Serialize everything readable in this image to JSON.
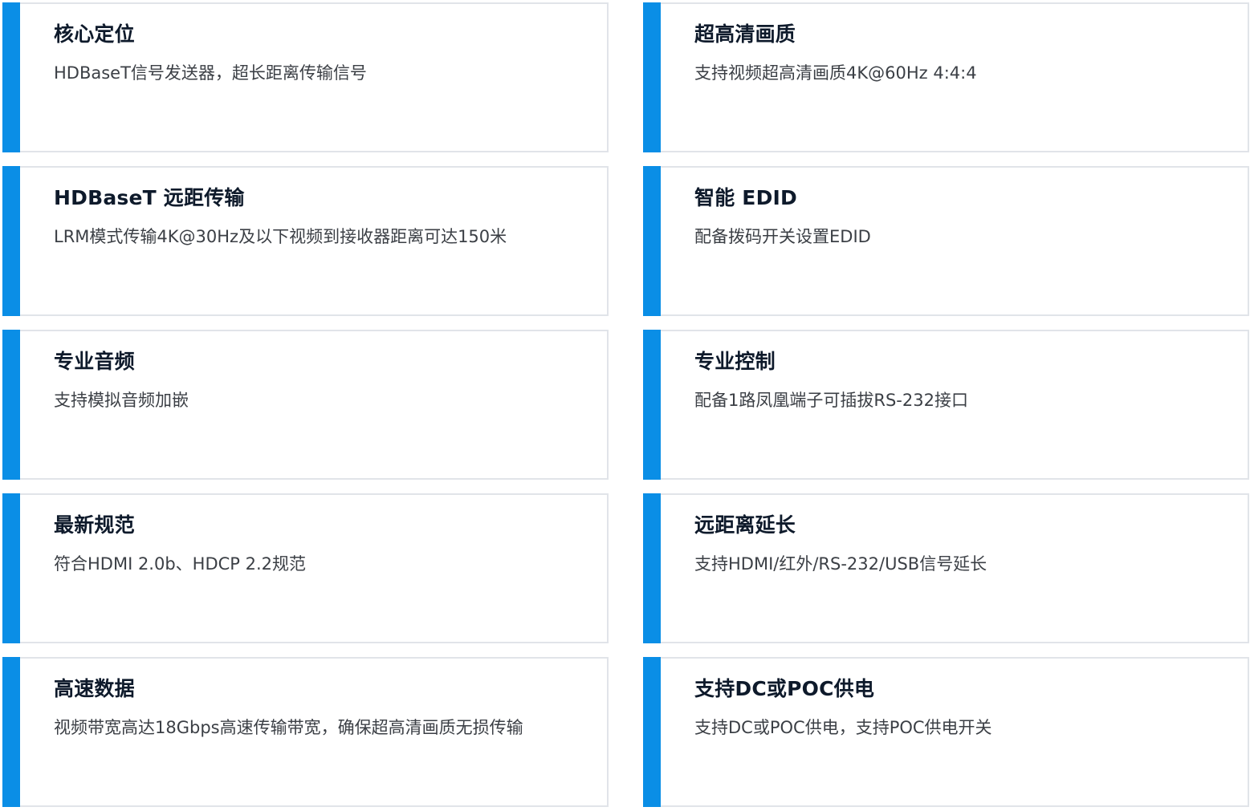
{
  "colors": {
    "accent": "#0a8ee6",
    "card_border": "#e1e4e9",
    "title": "#0e1a2b",
    "desc": "#3b3f45"
  },
  "features": [
    {
      "title": "核心定位",
      "desc": "HDBaseT信号发送器，超长距离传输信号"
    },
    {
      "title": "超高清画质",
      "desc": "支持视频超高清画质4K@60Hz 4:4:4"
    },
    {
      "title": "HDBaseT 远距传输",
      "desc": "LRM模式传输4K@30Hz及以下视频到接收器距离可达150米"
    },
    {
      "title": "智能 EDID",
      "desc": "配备拨码开关设置EDID"
    },
    {
      "title": "专业音频",
      "desc": "支持模拟音频加嵌"
    },
    {
      "title": "专业控制",
      "desc": "配备1路凤凰端子可插拔RS-232接口"
    },
    {
      "title": "最新规范",
      "desc": "符合HDMI 2.0b、HDCP 2.2规范"
    },
    {
      "title": "远距离延长",
      "desc": "支持HDMI/红外/RS-232/USB信号延长"
    },
    {
      "title": "高速数据",
      "desc": "视频带宽高达18Gbps高速传输带宽，确保超高清画质无损传输"
    },
    {
      "title": "支持DC或POC供电",
      "desc": "支持DC或POC供电，支持POC供电开关"
    }
  ]
}
